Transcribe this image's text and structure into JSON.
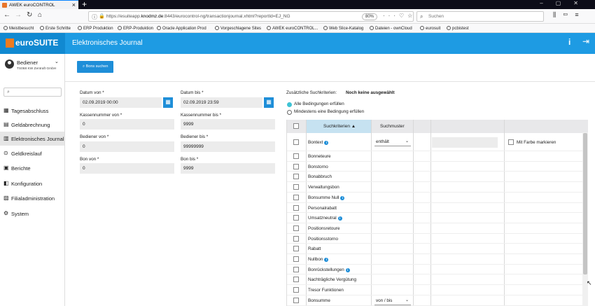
{
  "browser": {
    "tab_title": "AWEK euroCONTROL",
    "url_prefix": "https://esuiteapp.",
    "url_domain": "knodmz.de",
    "url_rest": ":8443/eurocontrol-ng/transactionjournal.xhtml?reportId=EJ_NG",
    "zoom": "80%",
    "search_placeholder": "Suchen",
    "bookmarks": [
      "Meistbesucht",
      "Erste Schritte",
      "ERP Produktion",
      "ERP-Produktion",
      "Oracle Application Prod",
      "Vorgeschlagene Sites",
      "AWEK euroCONTROL...",
      "Web Slice-Katalog",
      "Dateien - ownCloud",
      "eurosuit",
      "pcbistest"
    ]
  },
  "app": {
    "logo": "euroSUITE",
    "page_title": "Elektronisches Journal",
    "accent": "#1e9be3",
    "orange": "#ee7b1f"
  },
  "user": {
    "name": "Bediener",
    "company": "TS068 KW Zentraft GmbH"
  },
  "sidebar": {
    "items": [
      "Tagesabschluss",
      "Geldabrechnung",
      "Elektronisches Journal",
      "Geldkreislauf",
      "Berichte",
      "Konfiguration",
      "Filialadministration",
      "System"
    ]
  },
  "toolbar": {
    "search_label": "Bons suchen"
  },
  "form": {
    "datum_von_label": "Datum von *",
    "datum_von": "02.09.2019 00:00",
    "datum_bis_label": "Datum bis *",
    "datum_bis": "02.09.2019 23:59",
    "kasse_von_label": "Kassennummer von *",
    "kasse_von": "0",
    "kasse_bis_label": "Kassennummer bis *",
    "kasse_bis": "9999",
    "bed_von_label": "Bediener von *",
    "bed_von": "0",
    "bed_bis_label": "Bediener bis *",
    "bed_bis": "99999999",
    "bon_von_label": "Bon von *",
    "bon_von": "0",
    "bon_bis_label": "Bon bis *",
    "bon_bis": "9999"
  },
  "criteria": {
    "label": "Zusätzliche Suchkriterien:",
    "value": "Noch keine ausgewählt",
    "radio_all": "Alle Bedingungen erfüllen",
    "radio_any": "Mindestens eine Bedingung erfüllen",
    "col_criteria": "Suchkriterien",
    "col_pattern": "Suchmuster",
    "bontext": "Bontext",
    "bontext_pattern": "enthält",
    "mark_color": "Mit Farbe markieren",
    "rows": [
      {
        "t": "Bonneteure",
        "i": false
      },
      {
        "t": "Bonstorno",
        "i": false
      },
      {
        "t": "Bonabbruch",
        "i": false
      },
      {
        "t": "Verwaltungsbon",
        "i": false
      },
      {
        "t": "Bonsumme Null",
        "i": true
      },
      {
        "t": "Personalrabatt",
        "i": false
      },
      {
        "t": "Umsatzneutral",
        "i": true
      },
      {
        "t": "Positionsretoure",
        "i": false
      },
      {
        "t": "Positionsstorno",
        "i": false
      },
      {
        "t": "Rabatt",
        "i": false
      },
      {
        "t": "Nullbon",
        "i": true
      },
      {
        "t": "Bonrückstellungen",
        "i": true
      },
      {
        "t": "Nachträgliche Vergütung",
        "i": false
      },
      {
        "t": "Tresor Funktionen",
        "i": false
      }
    ],
    "bonsumme": "Bonsumme",
    "bonsumme_pattern": "von / bis"
  }
}
